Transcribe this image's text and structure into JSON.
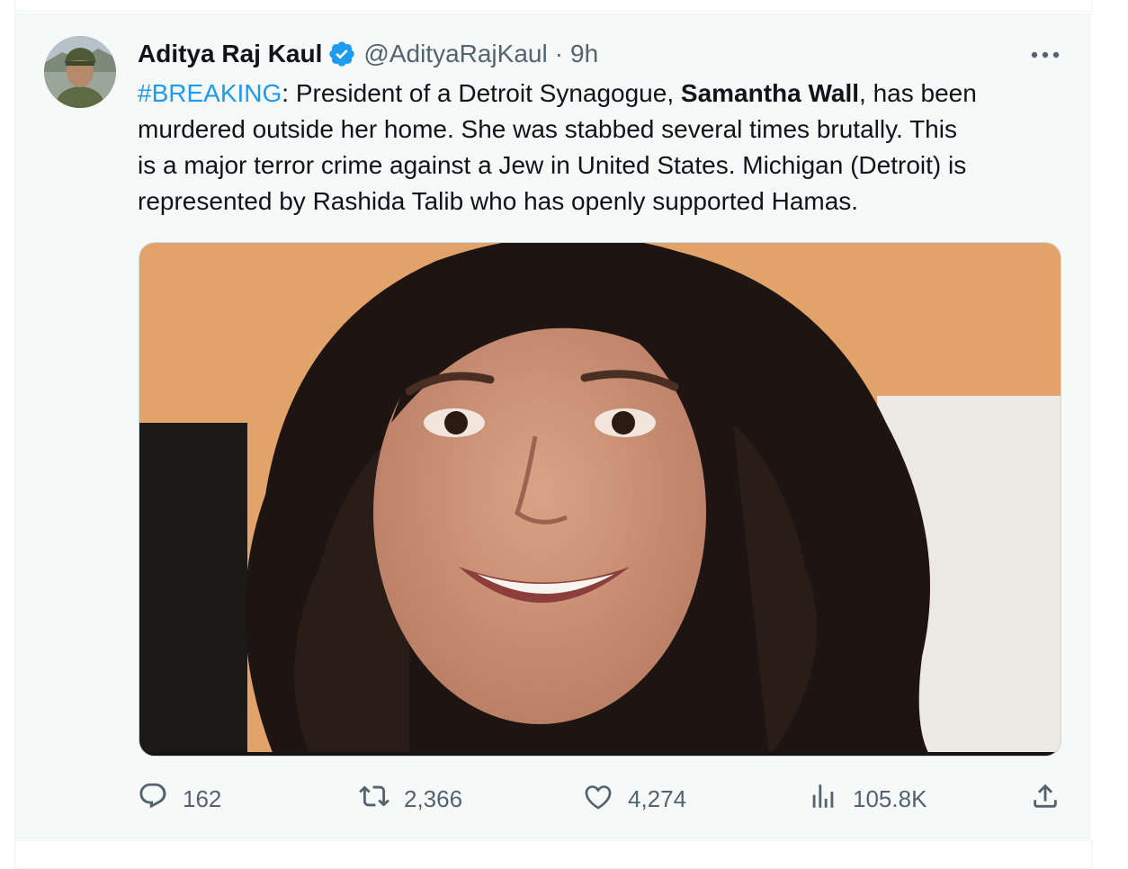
{
  "tweet": {
    "display_name": "Aditya Raj Kaul",
    "handle": "@AdityaRajKaul",
    "separator": "·",
    "time": "9h",
    "text": {
      "hashtag": "#BREAKING",
      "part1": ": President of a Detroit Synagogue, ",
      "bold_name": "Samantha Wall",
      "part2": ", has been",
      "line2": "murdered outside her home. She was stabbed several times brutally. This",
      "line3": "is a major terror crime against a Jew in United States. Michigan (Detroit) is",
      "line4": "represented by Rashida Talib who has openly supported Hamas."
    },
    "stats": {
      "replies": "162",
      "retweets": "2,366",
      "likes": "4,274",
      "views": "105.8K"
    },
    "icons": {
      "verified": "verified-badge-icon",
      "more": "more-options-icon",
      "reply": "reply-icon",
      "retweet": "retweet-icon",
      "like": "heart-icon",
      "views": "views-chart-icon",
      "share": "share-icon"
    }
  },
  "colors": {
    "accent": "#1d9bf0",
    "text": "#0f1419",
    "muted": "#536471",
    "card_bg": "#f7f9f9"
  }
}
